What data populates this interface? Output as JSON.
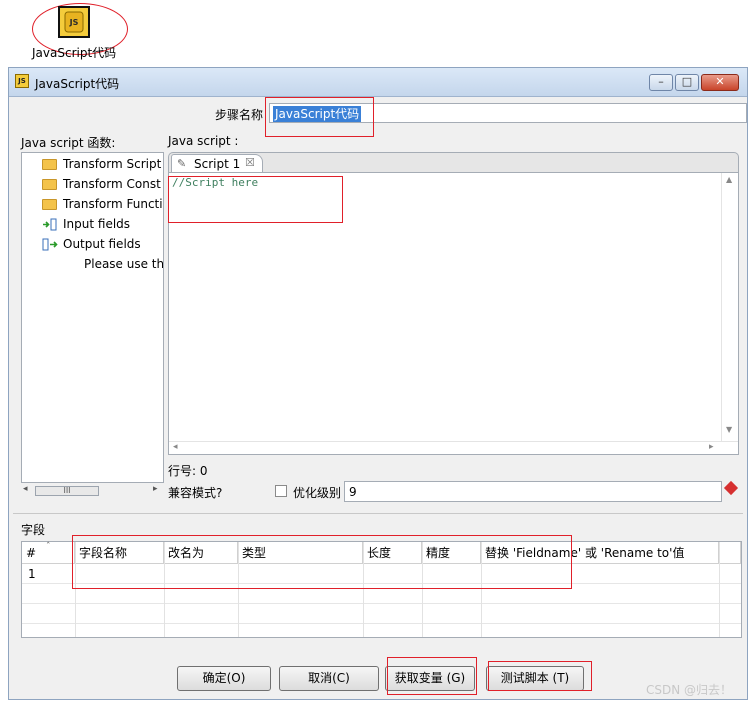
{
  "step_icon": {
    "glyph": "JS",
    "label": "JavaScript代码"
  },
  "window": {
    "title": "JavaScript代码",
    "minimize": "–",
    "maximize": "□",
    "close": "✕"
  },
  "step_name": {
    "label": "步骤名称",
    "value": "JavaScript代码"
  },
  "functions_panel": {
    "label": "Java script 函数:",
    "items": [
      {
        "label": "Transform Script",
        "icon": "folder-icon"
      },
      {
        "label": "Transform Const",
        "icon": "folder-icon"
      },
      {
        "label": "Transform Functi",
        "icon": "folder-icon"
      },
      {
        "label": "Input fields",
        "icon": "input-fields-icon"
      },
      {
        "label": "Output fields",
        "icon": "output-fields-icon"
      },
      {
        "label": "Please use th",
        "icon": ""
      }
    ],
    "scroll_thumb": "III"
  },
  "script_panel": {
    "label": "Java script :",
    "tab_label": "Script 1",
    "tab_close": "☒",
    "code": "//Script here"
  },
  "line_number": {
    "label": "行号: 0"
  },
  "compat_mode": {
    "label": "兼容模式?"
  },
  "optimize": {
    "label": "优化级别",
    "value": "9"
  },
  "fields": {
    "section_label": "字段",
    "columns": [
      "#",
      "字段名称",
      "改名为",
      "类型",
      "长度",
      "精度",
      "替换 'Fieldname' 或 'Rename to'值"
    ],
    "rows": [
      {
        "index": "1"
      }
    ]
  },
  "buttons": {
    "ok": "确定(O)",
    "cancel": "取消(C)",
    "get_variables": "获取变量 (G)",
    "test_script": "测试脚本 (T)"
  },
  "watermark": "CSDN @归去！",
  "colors": {
    "highlight_box": "#e0202a",
    "selection": "#3a80d7",
    "code_comment": "#3f7f5f"
  }
}
